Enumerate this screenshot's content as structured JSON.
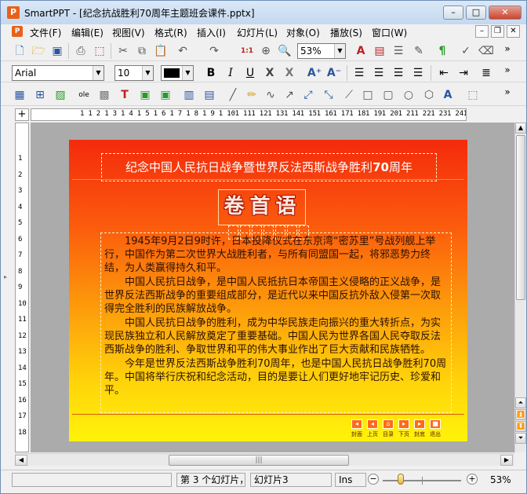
{
  "window": {
    "app_icon_glyph": "P",
    "title": "SmartPPT - [纪念抗战胜利70周年主题班会课件.pptx]",
    "controls": {
      "minimize": "–",
      "maximize": "□",
      "close": "✕"
    }
  },
  "menubar": {
    "doc_icon_glyph": "P",
    "items": [
      "文件(F)",
      "编辑(E)",
      "视图(V)",
      "格式(R)",
      "插入(I)",
      "幻灯片(L)",
      "对象(O)",
      "播放(S)",
      "窗口(W)"
    ],
    "mdi": {
      "minimize": "–",
      "restore": "❐",
      "close": "✕"
    }
  },
  "toolbar1": {
    "icons": [
      "new-file-icon",
      "open-folder-icon",
      "save-icon",
      "print-icon",
      "export-pdf-icon",
      "cut-icon",
      "copy-icon",
      "paste-icon",
      "undo-icon",
      "redo-icon",
      "actual-size-icon",
      "zoom-find-icon",
      "zoom-icon"
    ],
    "zoom_value": "53%",
    "icons_right": [
      "font-color-icon",
      "picture-text-icon",
      "notes-icon",
      "format-painter-icon",
      "text-direction-icon",
      "spellcheck-icon",
      "clear-format-icon"
    ],
    "more": "»"
  },
  "toolbar2": {
    "font_family": "Arial",
    "font_size": "10",
    "color_swatch": "#000000",
    "bold": "B",
    "italic": "I",
    "underline": "U",
    "strike": "X",
    "outline": "X",
    "grow": "A⁺",
    "shrink": "A⁻",
    "more": "»"
  },
  "toolbar3": {
    "more": "»"
  },
  "ruler": {
    "corner_glyph": "+",
    "h_ticks": [
      "1",
      "1",
      "2",
      "1",
      "3",
      "1",
      "4",
      "1",
      "5",
      "1",
      "6",
      "1",
      "7",
      "1",
      "8",
      "1",
      "9",
      "1",
      "10",
      "1",
      "11",
      "1",
      "12",
      "1",
      "13",
      "1",
      "14",
      "1",
      "15",
      "1",
      "16",
      "1",
      "17",
      "1",
      "18",
      "1",
      "19",
      "1",
      "20",
      "1",
      "21",
      "1",
      "22",
      "1",
      "23",
      "1",
      "24",
      "1",
      "25"
    ],
    "v_ticks": [
      "1",
      "2",
      "3",
      "4",
      "5",
      "6",
      "7",
      "8",
      "9",
      "10",
      "11",
      "12",
      "13",
      "14",
      "15",
      "16",
      "17",
      "18"
    ]
  },
  "slide": {
    "title_prefix": "纪念中国人民抗日战争暨世界反法西斯战争胜利",
    "title_bold": "70",
    "title_suffix": "周年",
    "heading": "卷首语",
    "paragraphs": [
      "1945年9月2日9时许，日本投降仪式在东京湾“密苏里”号战列舰上举行，中国作为第二次世界大战胜利者，与所有同盟国一起，将邪恶势力终结，为人类赢得持久和平。",
      "中国人民抗日战争，是中国人民抵抗日本帝国主义侵略的正义战争，是世界反法西斯战争的重要组成部分，是近代以来中国反抗外敌入侵第一次取得完全胜利的民族解放战争。",
      "中国人民抗日战争的胜利，成为中华民族走向振兴的重大转折点，为实现民族独立和人民解放奠定了重要基础。中国人民为世界各国人民夺取反法西斯战争的胜利、争取世界和平的伟大事业作出了巨大贡献和民族牺牲。",
      "今年是世界反法西斯战争胜利70周年，也是中国人民抗日战争胜利70周年。中国将举行庆祝和纪念活动，目的是要让人们更好地牢记历史、珍爱和平。"
    ],
    "nav": [
      {
        "glyph": "◂",
        "label": "封面"
      },
      {
        "glyph": "◂",
        "label": "上页"
      },
      {
        "glyph": "⌂",
        "label": "目录"
      },
      {
        "glyph": "▸",
        "label": "下页"
      },
      {
        "glyph": "▸",
        "label": "封底"
      },
      {
        "glyph": "■",
        "label": "退出"
      }
    ],
    "colors": {
      "top": "#f42a0c",
      "bottom": "#fff30a",
      "nav": "#ff6a1a"
    }
  },
  "scroll": {
    "up": "▲",
    "down": "▼",
    "left": "◀",
    "right": "▶",
    "first": "⏶",
    "prev": "⏫",
    "next": "⏬",
    "last": "⏷",
    "thumb": "|||"
  },
  "status": {
    "field1": "",
    "slide_pos": "第 3 个幻灯片，",
    "slide_name": "幻灯片3",
    "mode": "Ins",
    "zoom_minus": "−",
    "zoom_plus": "+",
    "zoom": "53%"
  }
}
